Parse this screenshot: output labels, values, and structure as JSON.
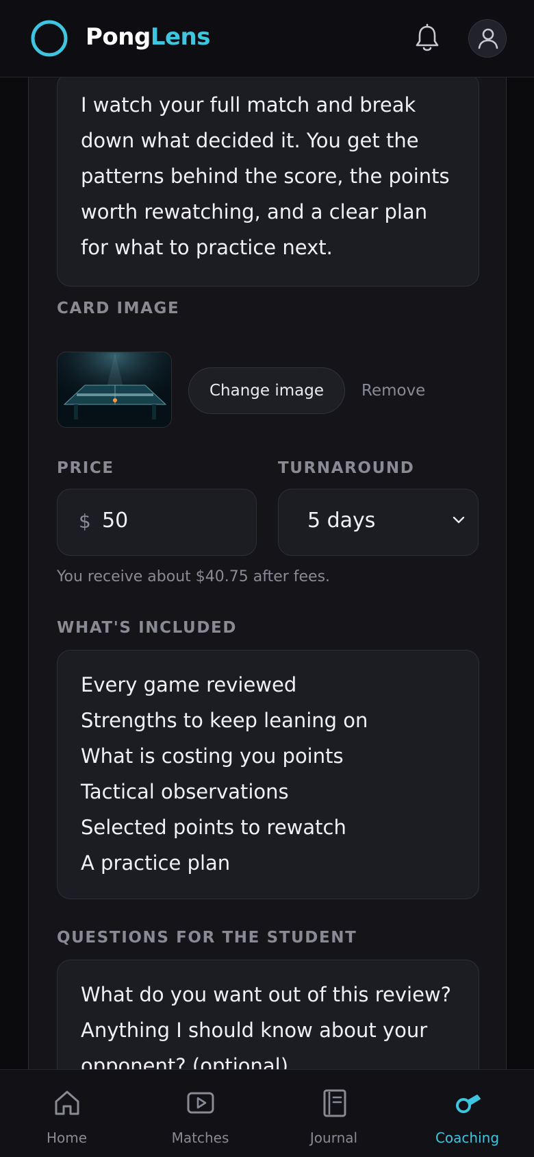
{
  "header": {
    "brand_part1": "Pong",
    "brand_part2": "Lens",
    "brand_color": "#3ec6e0"
  },
  "form": {
    "description_text": "I watch your full match and break\ndown what decided it. You get the\npatterns behind the score, the points\nworth rewatching, and a clear plan\nfor what to practice next.",
    "card_image": {
      "label": "CARD IMAGE",
      "change_label": "Change image",
      "remove_label": "Remove"
    },
    "price": {
      "label": "PRICE",
      "currency": "$",
      "value": "50"
    },
    "turnaround": {
      "label": "TURNAROUND",
      "value": "5 days"
    },
    "fee_note": "You receive about $40.75 after fees.",
    "included": {
      "label": "WHAT'S INCLUDED",
      "text": "Every game reviewed\nStrengths to keep leaning on\nWhat is costing you points\nTactical observations\nSelected points to rewatch\nA practice plan"
    },
    "questions": {
      "label": "QUESTIONS FOR THE STUDENT",
      "text": "What do you want out of this review?\nAnything I should know about your\nopponent? (optional)"
    }
  },
  "nav": {
    "items": [
      {
        "label": "Home",
        "icon": "home-icon"
      },
      {
        "label": "Matches",
        "icon": "play-icon"
      },
      {
        "label": "Journal",
        "icon": "journal-icon"
      },
      {
        "label": "Coaching",
        "icon": "whistle-icon",
        "active": true
      }
    ]
  }
}
